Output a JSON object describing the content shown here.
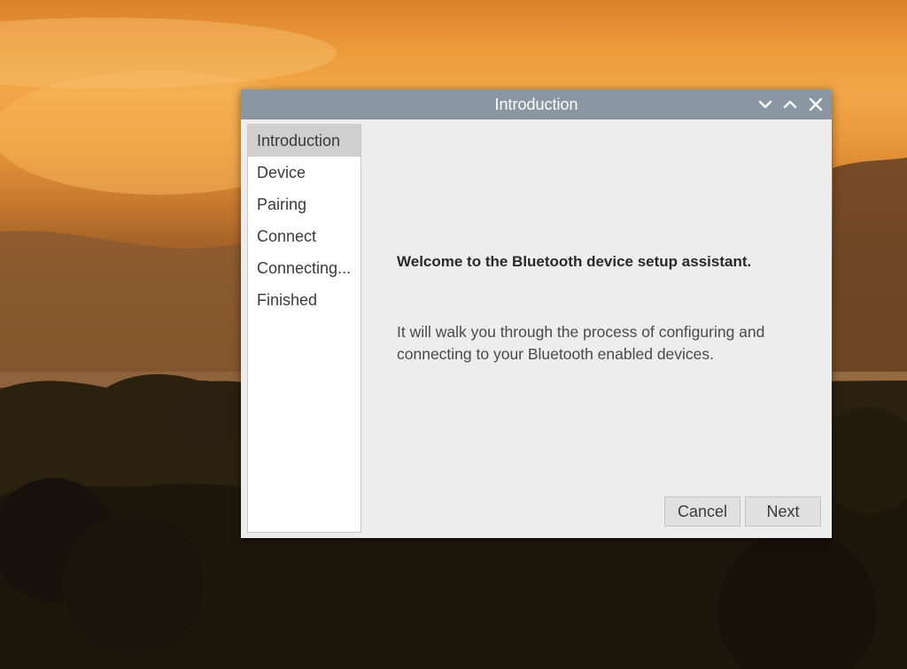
{
  "window": {
    "title": "Introduction",
    "controls": {
      "minimize_icon": "chevron-down-icon",
      "maximize_icon": "chevron-up-icon",
      "close_icon": "close-icon"
    }
  },
  "sidebar": {
    "items": [
      {
        "label": "Introduction",
        "active": true
      },
      {
        "label": "Device",
        "active": false
      },
      {
        "label": "Pairing",
        "active": false
      },
      {
        "label": "Connect",
        "active": false
      },
      {
        "label": "Connecting...",
        "active": false
      },
      {
        "label": "Finished",
        "active": false
      }
    ]
  },
  "main": {
    "heading": "Welcome to the Bluetooth device setup assistant.",
    "description_line1": "It will walk you through the process of configuring and",
    "description_line2": "connecting to your Bluetooth enabled devices."
  },
  "buttons": {
    "cancel_label": "Cancel",
    "next_label": "Next"
  },
  "colors": {
    "titlebar": "#8a97a3",
    "window_bg": "#ededed",
    "active_step": "#cfcfcf"
  }
}
